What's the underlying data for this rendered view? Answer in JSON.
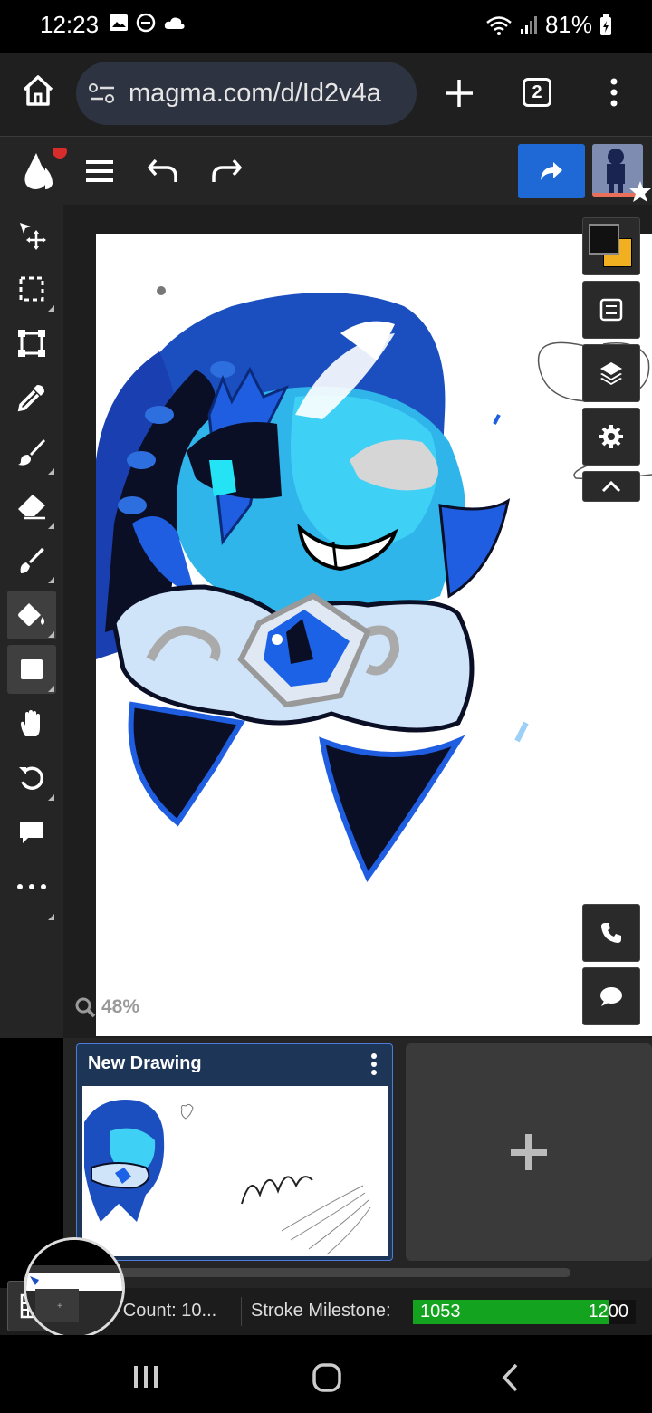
{
  "status_bar": {
    "time": "12:23",
    "battery": "81%"
  },
  "browser": {
    "url": "magma.com/d/Id2v4a",
    "tab_count": "2"
  },
  "canvas": {
    "zoom": "48%"
  },
  "drawings": [
    {
      "title": "New Drawing"
    }
  ],
  "status_strip": {
    "stroke_count_label": "oke Count: 10...",
    "milestone_label": "Stroke Milestone:",
    "milestone_current": "1053",
    "milestone_target": "1200",
    "milestone_progress": 0.877
  },
  "colors": {
    "primary": "#111111",
    "secondary": "#f0b020",
    "accent": "#1f69d6",
    "progress": "#14a31e"
  },
  "icons": {
    "browser": [
      "home-icon",
      "site-settings-icon",
      "new-tab-icon",
      "tab-switcher-icon",
      "kebab-menu-icon"
    ],
    "tools": [
      "move-icon",
      "selection-icon",
      "transform-icon",
      "eyedropper-icon",
      "brush-icon",
      "eraser-icon",
      "smudge-icon",
      "paint-bucket-icon",
      "rectangle-icon",
      "hand-icon",
      "rotate-icon",
      "comment-icon",
      "more-icon"
    ]
  }
}
